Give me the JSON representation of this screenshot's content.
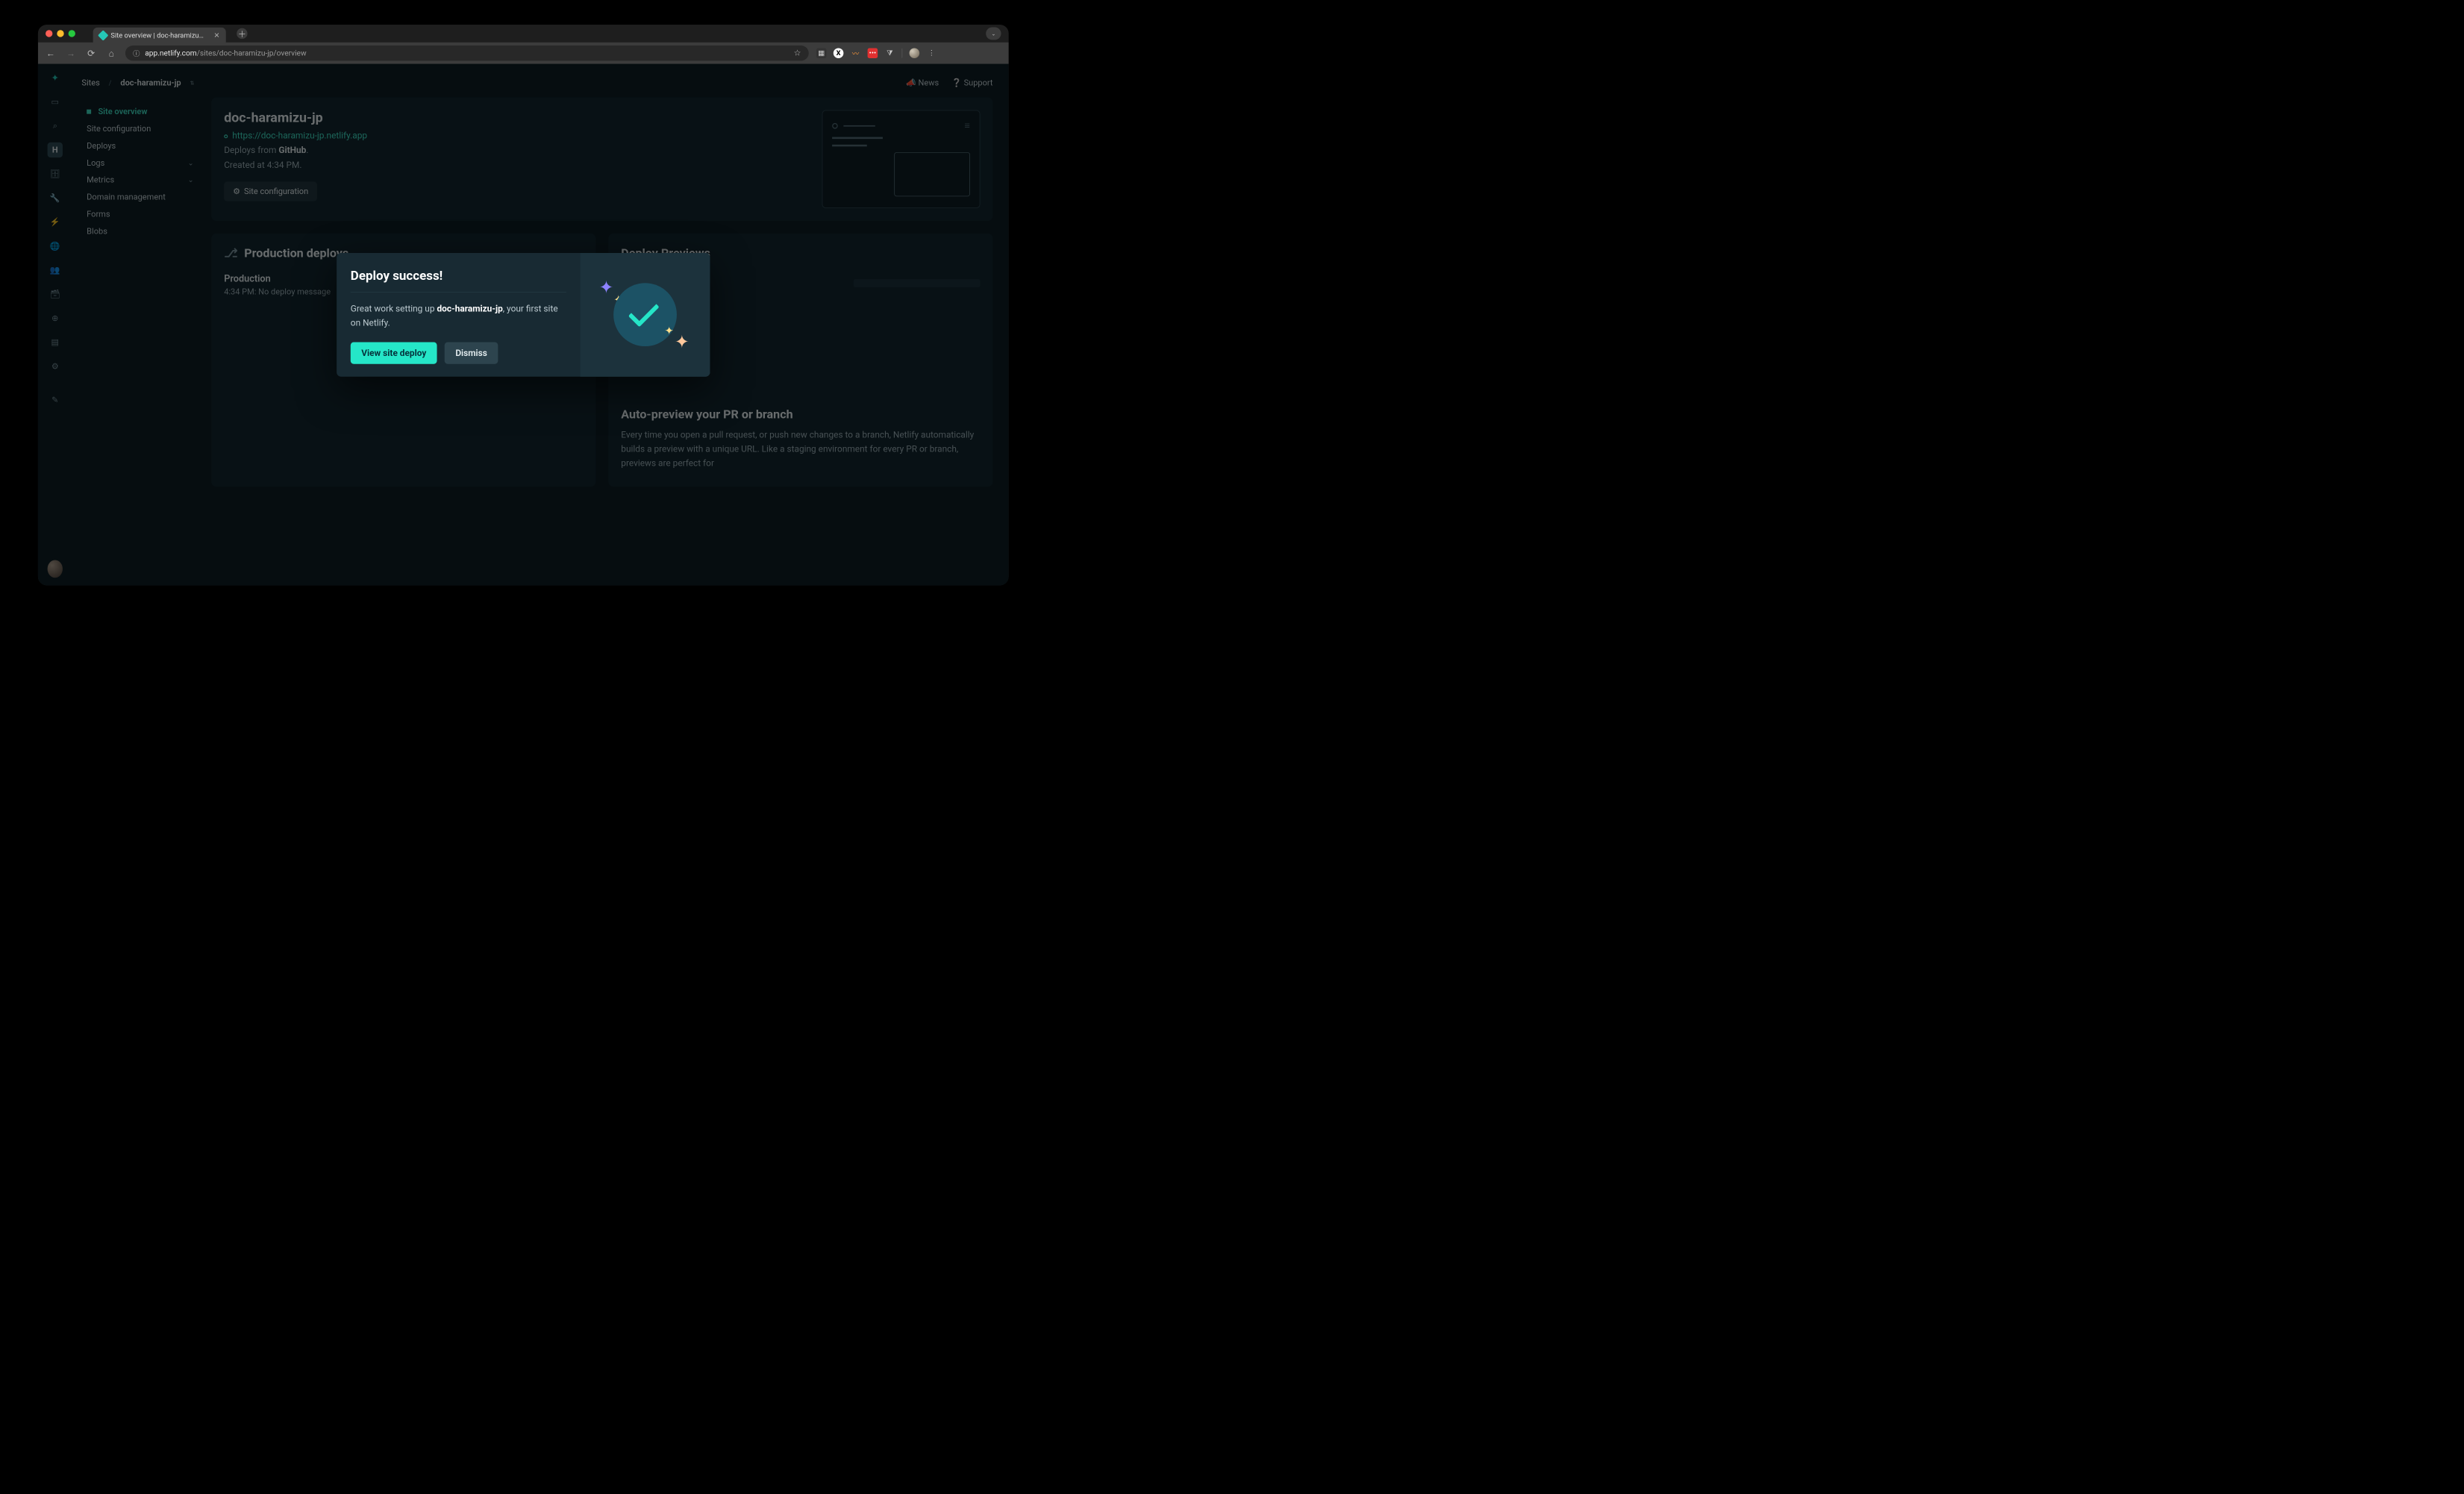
{
  "browser": {
    "tab_title": "Site overview | doc-haramizu…",
    "url_prefix": "app.netlify.com",
    "url_path": "/sites/doc-haramizu-jp/overview"
  },
  "breadcrumb": {
    "root": "Sites",
    "site": "doc-haramizu-jp"
  },
  "header_links": {
    "news": "News",
    "support": "Support"
  },
  "leftnav": {
    "items": [
      "Site overview",
      "Site configuration",
      "Deploys",
      "Logs",
      "Metrics",
      "Domain management",
      "Forms",
      "Blobs"
    ]
  },
  "site": {
    "name": "doc-haramizu-jp",
    "url": "https://doc-haramizu-jp.netlify.app",
    "deploys_from_prefix": "Deploys from ",
    "deploys_from_source": "GitHub",
    "created": "Created at 4:34 PM.",
    "config_btn": "Site configuration"
  },
  "sections": {
    "production": "Production deploys",
    "previews": "Deploy Previews",
    "prod_item_title": "Production",
    "prod_item_sub": "4:34 PM: No deploy message"
  },
  "preview_article": {
    "heading": "Auto-preview your PR or branch",
    "body": "Every time you open a pull request, or push new changes to a branch, Netlify automatically builds a preview with a unique URL. Like a staging environment for every PR or branch, previews are perfect for"
  },
  "modal": {
    "title": "Deploy success!",
    "body_prefix": "Great work setting up ",
    "body_site": "doc-haramizu-jp",
    "body_suffix": ", your first site on Netlify.",
    "primary": "View site deploy",
    "secondary": "Dismiss"
  },
  "iconrail_letter": "H"
}
